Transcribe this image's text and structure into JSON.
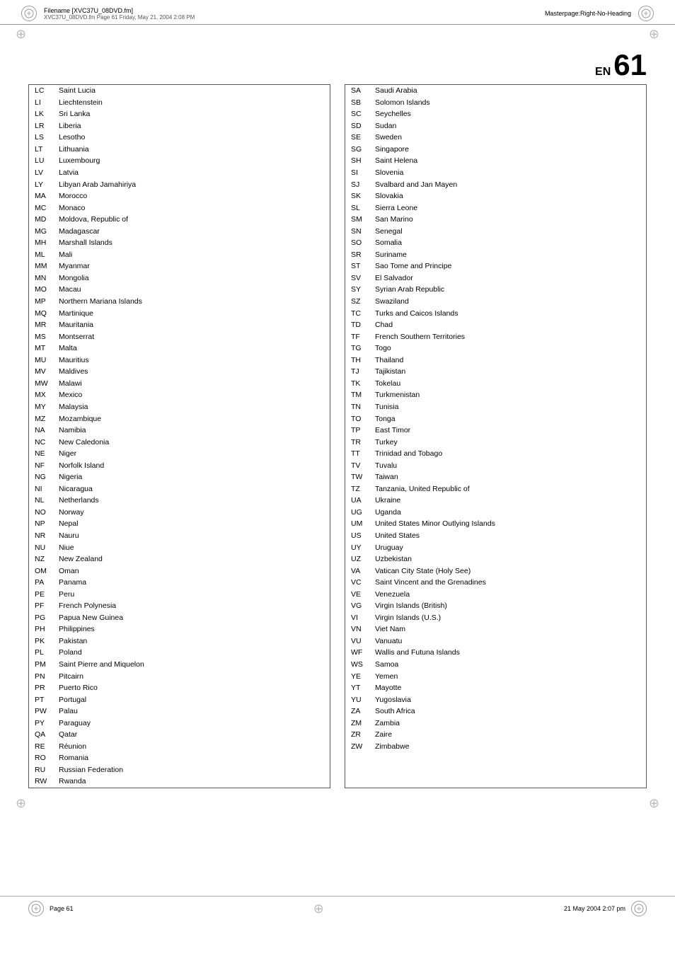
{
  "header": {
    "filename": "Filename [XVC37U_08DVD.fm]",
    "sub_header": "XVC37U_08DVD.fm  Page 61  Friday, May 21, 2004  2:08 PM",
    "masterpage": "Masterpage:Right-No-Heading"
  },
  "page_title": {
    "en_label": "EN",
    "page_number": "61"
  },
  "left_countries": [
    {
      "code": "LC",
      "name": "Saint Lucia"
    },
    {
      "code": "LI",
      "name": "Liechtenstein"
    },
    {
      "code": "LK",
      "name": "Sri Lanka"
    },
    {
      "code": "LR",
      "name": "Liberia"
    },
    {
      "code": "LS",
      "name": "Lesotho"
    },
    {
      "code": "LT",
      "name": "Lithuania"
    },
    {
      "code": "LU",
      "name": "Luxembourg"
    },
    {
      "code": "LV",
      "name": "Latvia"
    },
    {
      "code": "LY",
      "name": "Libyan Arab Jamahiriya"
    },
    {
      "code": "MA",
      "name": "Morocco"
    },
    {
      "code": "MC",
      "name": "Monaco"
    },
    {
      "code": "MD",
      "name": "Moldova, Republic of"
    },
    {
      "code": "MG",
      "name": "Madagascar"
    },
    {
      "code": "MH",
      "name": "Marshall Islands"
    },
    {
      "code": "ML",
      "name": "Mali"
    },
    {
      "code": "MM",
      "name": "Myanmar"
    },
    {
      "code": "MN",
      "name": "Mongolia"
    },
    {
      "code": "MO",
      "name": "Macau"
    },
    {
      "code": "MP",
      "name": "Northern Mariana Islands"
    },
    {
      "code": "MQ",
      "name": "Martinique"
    },
    {
      "code": "MR",
      "name": "Mauritania"
    },
    {
      "code": "MS",
      "name": "Montserrat"
    },
    {
      "code": "MT",
      "name": "Malta"
    },
    {
      "code": "MU",
      "name": "Mauritius"
    },
    {
      "code": "MV",
      "name": "Maldives"
    },
    {
      "code": "MW",
      "name": "Malawi"
    },
    {
      "code": "MX",
      "name": "Mexico"
    },
    {
      "code": "MY",
      "name": "Malaysia"
    },
    {
      "code": "MZ",
      "name": "Mozambique"
    },
    {
      "code": "NA",
      "name": "Namibia"
    },
    {
      "code": "NC",
      "name": "New Caledonia"
    },
    {
      "code": "NE",
      "name": "Niger"
    },
    {
      "code": "NF",
      "name": "Norfolk Island"
    },
    {
      "code": "NG",
      "name": "Nigeria"
    },
    {
      "code": "NI",
      "name": "Nicaragua"
    },
    {
      "code": "NL",
      "name": "Netherlands"
    },
    {
      "code": "NO",
      "name": "Norway"
    },
    {
      "code": "NP",
      "name": "Nepal"
    },
    {
      "code": "NR",
      "name": "Nauru"
    },
    {
      "code": "NU",
      "name": "Niue"
    },
    {
      "code": "NZ",
      "name": "New Zealand"
    },
    {
      "code": "OM",
      "name": "Oman"
    },
    {
      "code": "PA",
      "name": "Panama"
    },
    {
      "code": "PE",
      "name": "Peru"
    },
    {
      "code": "PF",
      "name": "French Polynesia"
    },
    {
      "code": "PG",
      "name": "Papua New Guinea"
    },
    {
      "code": "PH",
      "name": "Philippines"
    },
    {
      "code": "PK",
      "name": "Pakistan"
    },
    {
      "code": "PL",
      "name": "Poland"
    },
    {
      "code": "PM",
      "name": "Saint Pierre and Miquelon"
    },
    {
      "code": "PN",
      "name": "Pitcairn"
    },
    {
      "code": "PR",
      "name": "Puerto Rico"
    },
    {
      "code": "PT",
      "name": "Portugal"
    },
    {
      "code": "PW",
      "name": "Palau"
    },
    {
      "code": "PY",
      "name": "Paraguay"
    },
    {
      "code": "QA",
      "name": "Qatar"
    },
    {
      "code": "RE",
      "name": "Réunion"
    },
    {
      "code": "RO",
      "name": "Romania"
    },
    {
      "code": "RU",
      "name": "Russian Federation"
    },
    {
      "code": "RW",
      "name": "Rwanda"
    }
  ],
  "right_countries": [
    {
      "code": "SA",
      "name": "Saudi Arabia"
    },
    {
      "code": "SB",
      "name": "Solomon Islands"
    },
    {
      "code": "SC",
      "name": "Seychelles"
    },
    {
      "code": "SD",
      "name": "Sudan"
    },
    {
      "code": "SE",
      "name": "Sweden"
    },
    {
      "code": "SG",
      "name": "Singapore"
    },
    {
      "code": "SH",
      "name": "Saint Helena"
    },
    {
      "code": "SI",
      "name": "Slovenia"
    },
    {
      "code": "SJ",
      "name": "Svalbard and Jan Mayen"
    },
    {
      "code": "SK",
      "name": "Slovakia"
    },
    {
      "code": "SL",
      "name": "Sierra Leone"
    },
    {
      "code": "SM",
      "name": "San Marino"
    },
    {
      "code": "SN",
      "name": "Senegal"
    },
    {
      "code": "SO",
      "name": "Somalia"
    },
    {
      "code": "SR",
      "name": "Suriname"
    },
    {
      "code": "ST",
      "name": "Sao Tome and Principe"
    },
    {
      "code": "SV",
      "name": "El Salvador"
    },
    {
      "code": "SY",
      "name": "Syrian Arab Republic"
    },
    {
      "code": "SZ",
      "name": "Swaziland"
    },
    {
      "code": "TC",
      "name": "Turks and Caicos Islands"
    },
    {
      "code": "TD",
      "name": "Chad"
    },
    {
      "code": "TF",
      "name": "French Southern Territories"
    },
    {
      "code": "TG",
      "name": "Togo"
    },
    {
      "code": "TH",
      "name": "Thailand"
    },
    {
      "code": "TJ",
      "name": "Tajikistan"
    },
    {
      "code": "TK",
      "name": "Tokelau"
    },
    {
      "code": "TM",
      "name": "Turkmenistan"
    },
    {
      "code": "TN",
      "name": "Tunisia"
    },
    {
      "code": "TO",
      "name": "Tonga"
    },
    {
      "code": "TP",
      "name": "East Timor"
    },
    {
      "code": "TR",
      "name": "Turkey"
    },
    {
      "code": "TT",
      "name": "Trinidad and Tobago"
    },
    {
      "code": "TV",
      "name": "Tuvalu"
    },
    {
      "code": "TW",
      "name": "Taiwan"
    },
    {
      "code": "TZ",
      "name": "Tanzania, United Republic of"
    },
    {
      "code": "UA",
      "name": "Ukraine"
    },
    {
      "code": "UG",
      "name": "Uganda"
    },
    {
      "code": "UM",
      "name": "United States Minor Outlying Islands"
    },
    {
      "code": "US",
      "name": "United States"
    },
    {
      "code": "UY",
      "name": "Uruguay"
    },
    {
      "code": "UZ",
      "name": "Uzbekistan"
    },
    {
      "code": "VA",
      "name": "Vatican City State (Holy See)"
    },
    {
      "code": "VC",
      "name": "Saint Vincent and the Grenadines"
    },
    {
      "code": "VE",
      "name": "Venezuela"
    },
    {
      "code": "VG",
      "name": "Virgin Islands (British)"
    },
    {
      "code": "VI",
      "name": "Virgin Islands (U.S.)"
    },
    {
      "code": "VN",
      "name": "Viet Nam"
    },
    {
      "code": "VU",
      "name": "Vanuatu"
    },
    {
      "code": "WF",
      "name": "Wallis and Futuna Islands"
    },
    {
      "code": "WS",
      "name": "Samoa"
    },
    {
      "code": "YE",
      "name": "Yemen"
    },
    {
      "code": "YT",
      "name": "Mayotte"
    },
    {
      "code": "YU",
      "name": "Yugoslavia"
    },
    {
      "code": "ZA",
      "name": "South Africa"
    },
    {
      "code": "ZM",
      "name": "Zambia"
    },
    {
      "code": "ZR",
      "name": "Zaire"
    },
    {
      "code": "ZW",
      "name": "Zimbabwe"
    }
  ],
  "footer": {
    "left": "Page 61",
    "right": "21 May 2004  2:07 pm"
  }
}
